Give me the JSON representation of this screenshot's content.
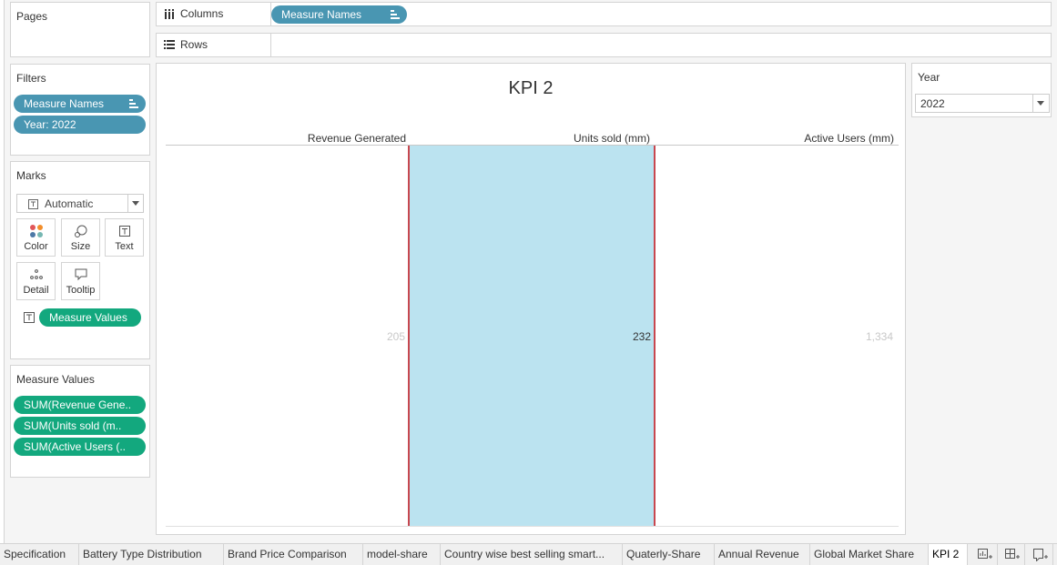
{
  "pages": {
    "title": "Pages"
  },
  "columns_shelf": {
    "label": "Columns",
    "pill": "Measure Names"
  },
  "rows_shelf": {
    "label": "Rows"
  },
  "filters": {
    "title": "Filters",
    "pills": [
      "Measure Names",
      "Year: 2022"
    ]
  },
  "marks": {
    "title": "Marks",
    "mark_type": "Automatic",
    "buttons": {
      "color": "Color",
      "size": "Size",
      "text": "Text",
      "detail": "Detail",
      "tooltip": "Tooltip"
    },
    "text_pill": "Measure Values"
  },
  "measure_values": {
    "title": "Measure Values",
    "pills": [
      "SUM(Revenue Gene..",
      "SUM(Units sold (m..",
      "SUM(Active Users (.."
    ]
  },
  "view": {
    "title": "KPI 2",
    "columns": [
      {
        "header": "Revenue Generated",
        "value": "205",
        "highlighted": false
      },
      {
        "header": "Units sold (mm)",
        "value": "232",
        "highlighted": true
      },
      {
        "header": "Active Users (mm)",
        "value": "1,334",
        "highlighted": false
      }
    ]
  },
  "year_filter": {
    "title": "Year",
    "value": "2022"
  },
  "tabs": [
    "Specification",
    "Battery Type Distribution",
    "Brand Price Comparison",
    "model-share",
    "Country wise best selling smart...",
    "Quaterly-Share",
    "Annual Revenue",
    "Global Market Share",
    "KPI 2"
  ],
  "active_tab": "KPI 2",
  "tab_icons": [
    "new-worksheet-icon",
    "new-dashboard-icon",
    "new-story-icon"
  ],
  "colors": {
    "pill_blue": "#4996b2",
    "pill_green": "#13a87e",
    "highlight_fill": "#bbe3f0",
    "highlight_border": "#c8474f"
  }
}
